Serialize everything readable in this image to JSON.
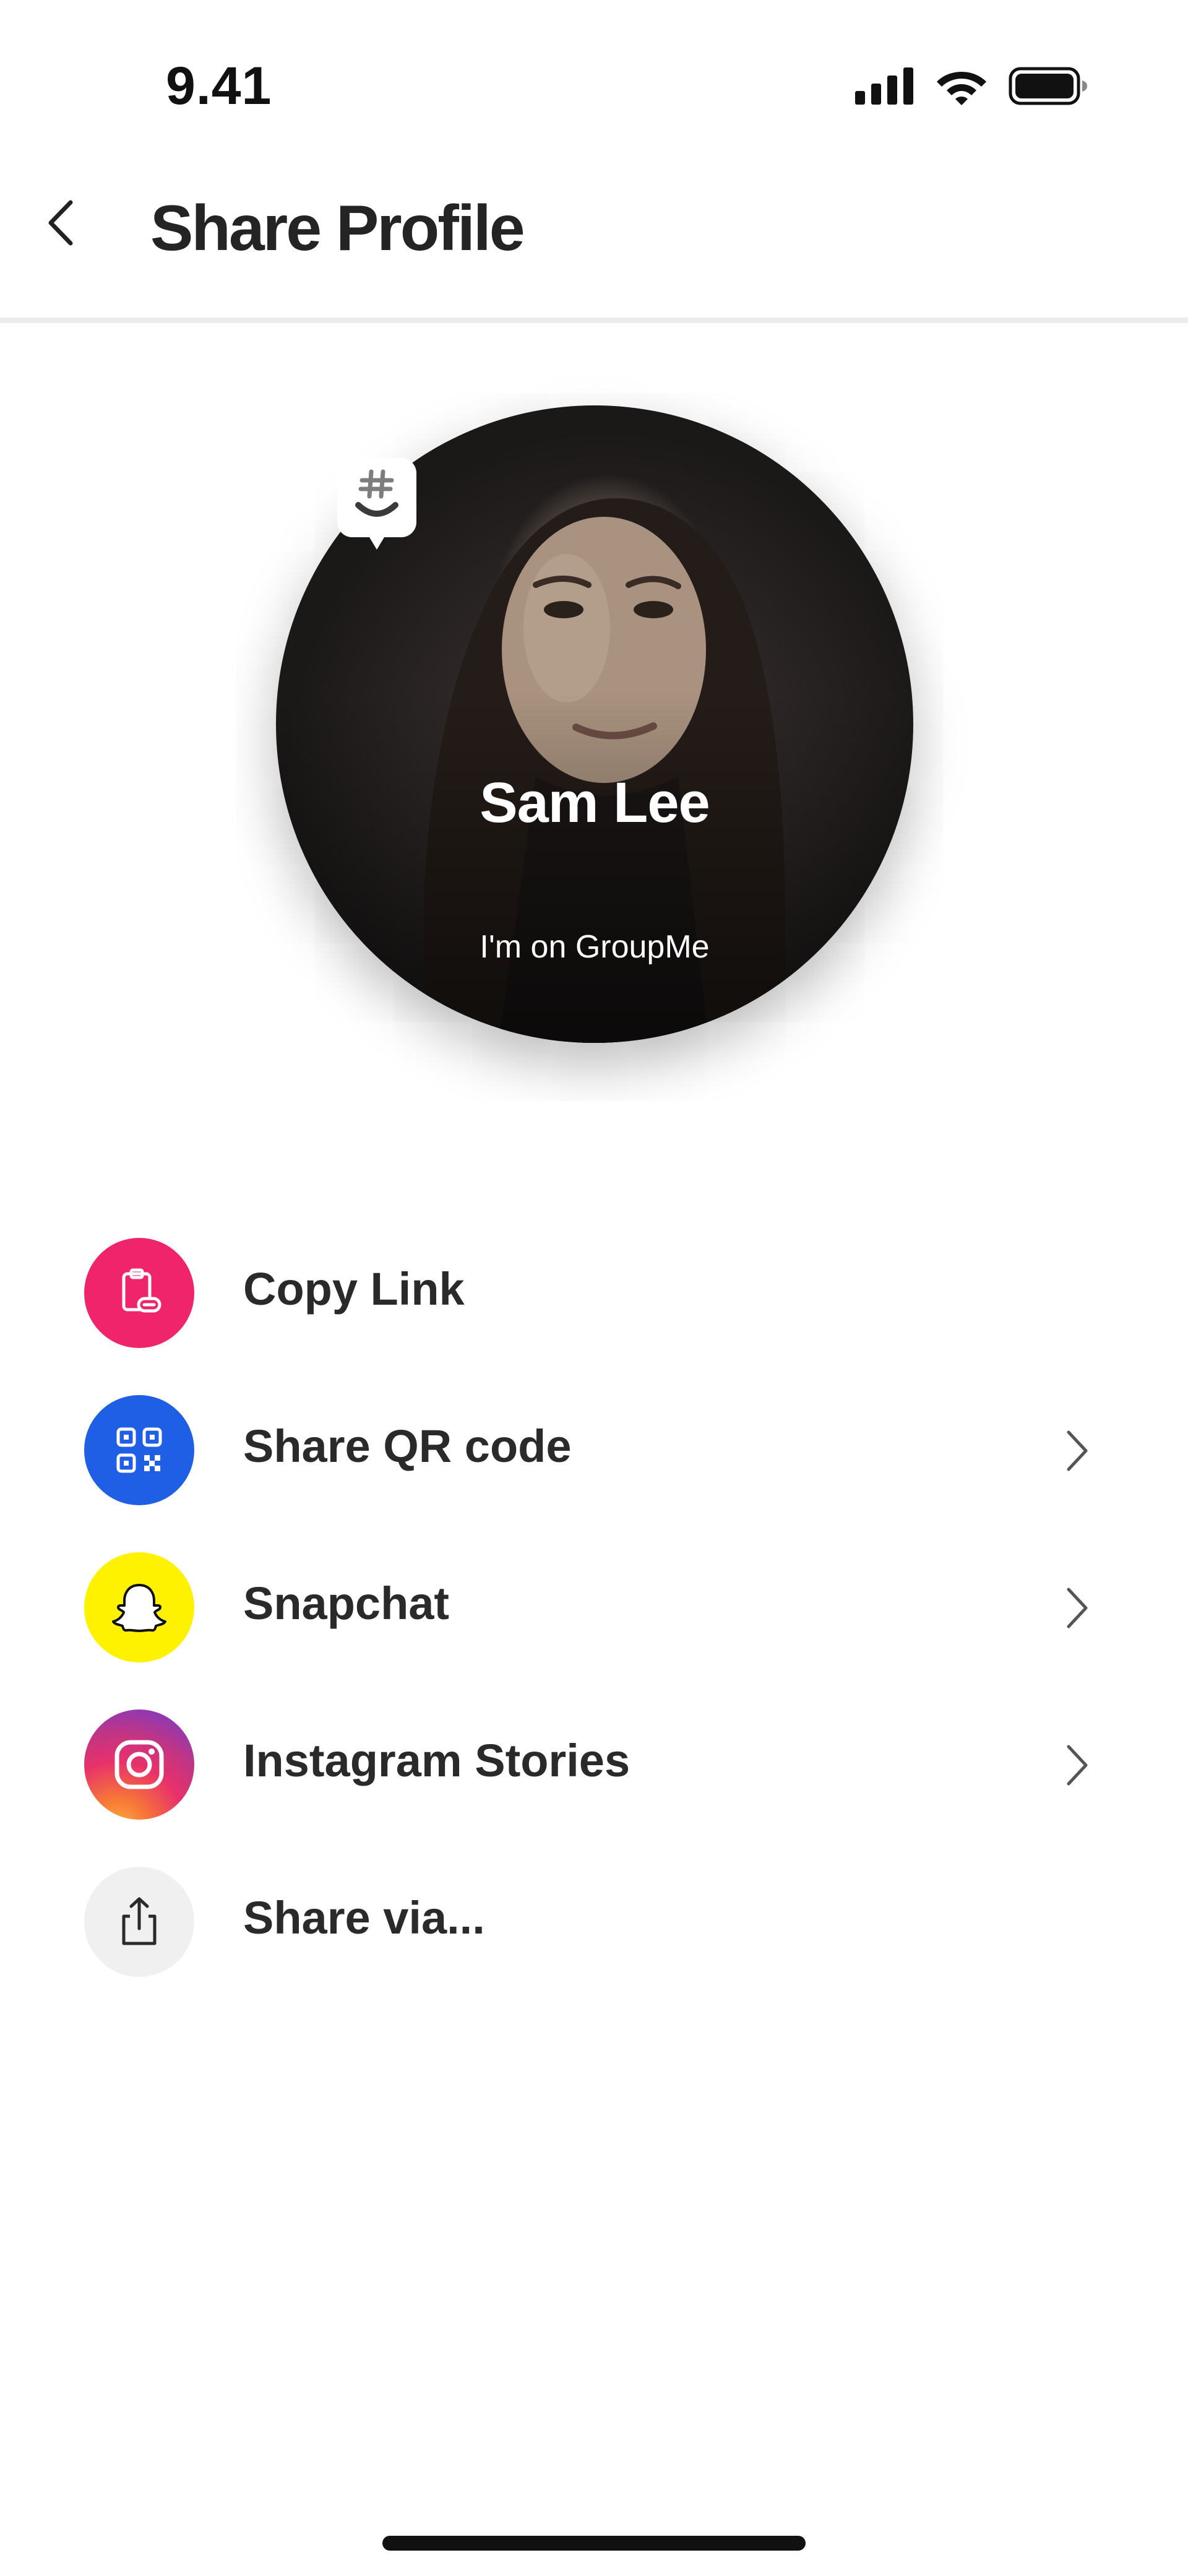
{
  "status_bar": {
    "time": "9.41",
    "icons": [
      "cellular-signal-icon",
      "wifi-icon",
      "battery-icon"
    ]
  },
  "header": {
    "back_icon": "chevron-left-icon",
    "title": "Share Profile"
  },
  "profile_card": {
    "name": "Sam Lee",
    "subtitle": "I'm on GroupMe",
    "badge_icon": "groupme-logo-icon"
  },
  "share_options": [
    {
      "label": "Copy Link",
      "icon": "clipboard-link-icon",
      "color": "#f0246b",
      "has_chevron": false
    },
    {
      "label": "Share QR code",
      "icon": "qr-code-icon",
      "color": "#1f5fe6",
      "has_chevron": true
    },
    {
      "label": "Snapchat",
      "icon": "snapchat-ghost-icon",
      "color": "#fff200",
      "has_chevron": true
    },
    {
      "label": "Instagram Stories",
      "icon": "instagram-icon",
      "color": "#e8316b",
      "has_chevron": true
    },
    {
      "label": "Share via...",
      "icon": "share-upload-icon",
      "color": "#f0f0f0",
      "has_chevron": false
    }
  ]
}
